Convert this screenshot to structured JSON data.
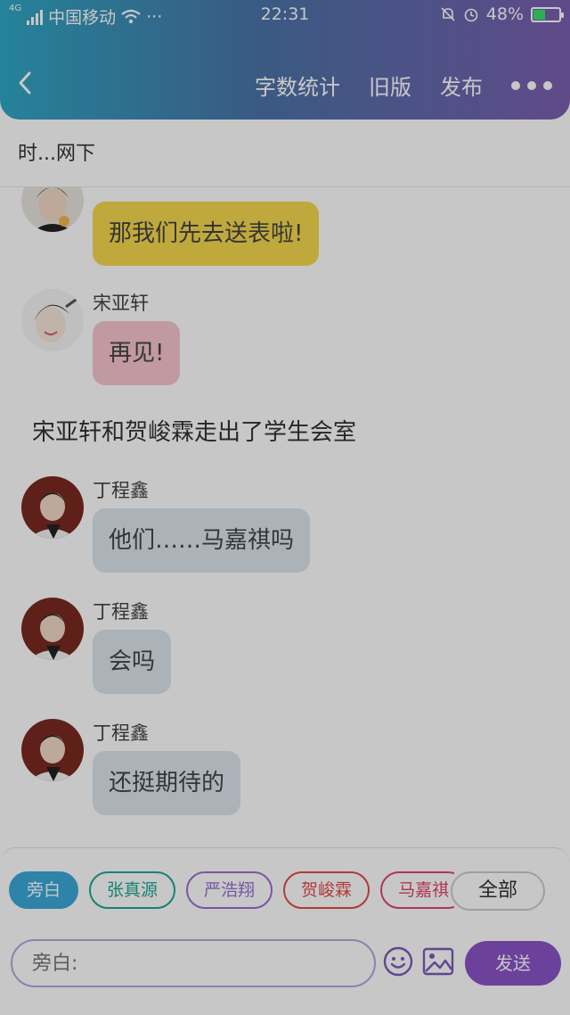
{
  "status_bar": {
    "network": "4G",
    "carrier": "中国移动",
    "more": "···",
    "time": "22:31",
    "battery_percent": "48%",
    "battery_level": 0.48
  },
  "nav": {
    "back_icon": "chevron-left-icon",
    "word_count": "字数统计",
    "old_version": "旧版",
    "publish": "发布",
    "more_icon": "three-dots-icon"
  },
  "title": "时...网下",
  "messages": [
    {
      "type": "bubble",
      "speaker": "",
      "text": "那我们先去送表啦!",
      "bubble_color": "#f7d94e",
      "avatar": "avatar-person-1"
    },
    {
      "type": "bubble",
      "speaker": "宋亚轩",
      "text": "再见!",
      "bubble_color": "#f7c6cd",
      "avatar": "avatar-person-2"
    },
    {
      "type": "narration",
      "text": "宋亚轩和贺峻霖走出了学生会室"
    },
    {
      "type": "bubble",
      "speaker": "丁程鑫",
      "text": "他们……马嘉祺吗",
      "bubble_color": "#dbe6ee",
      "avatar": "avatar-person-3"
    },
    {
      "type": "bubble",
      "speaker": "丁程鑫",
      "text": "会吗",
      "bubble_color": "#dbe6ee",
      "avatar": "avatar-person-3"
    },
    {
      "type": "bubble",
      "speaker": "丁程鑫",
      "text": "还挺期待的",
      "bubble_color": "#dbe6ee",
      "avatar": "avatar-person-3"
    }
  ],
  "characters": [
    {
      "name": "旁白",
      "color": "#3aa8d8",
      "selected": true
    },
    {
      "name": "张真源",
      "color": "#1aa895",
      "selected": false
    },
    {
      "name": "严浩翔",
      "color": "#9b6fd0",
      "selected": false
    },
    {
      "name": "贺峻霖",
      "color": "#e24b4b",
      "selected": false
    },
    {
      "name": "马嘉祺",
      "color": "#e0456e",
      "selected": false
    }
  ],
  "all_button": "全部",
  "input": {
    "placeholder": "旁白:"
  },
  "send_button": "发送",
  "icons": {
    "emoji": "smiley-icon",
    "image": "image-icon"
  }
}
